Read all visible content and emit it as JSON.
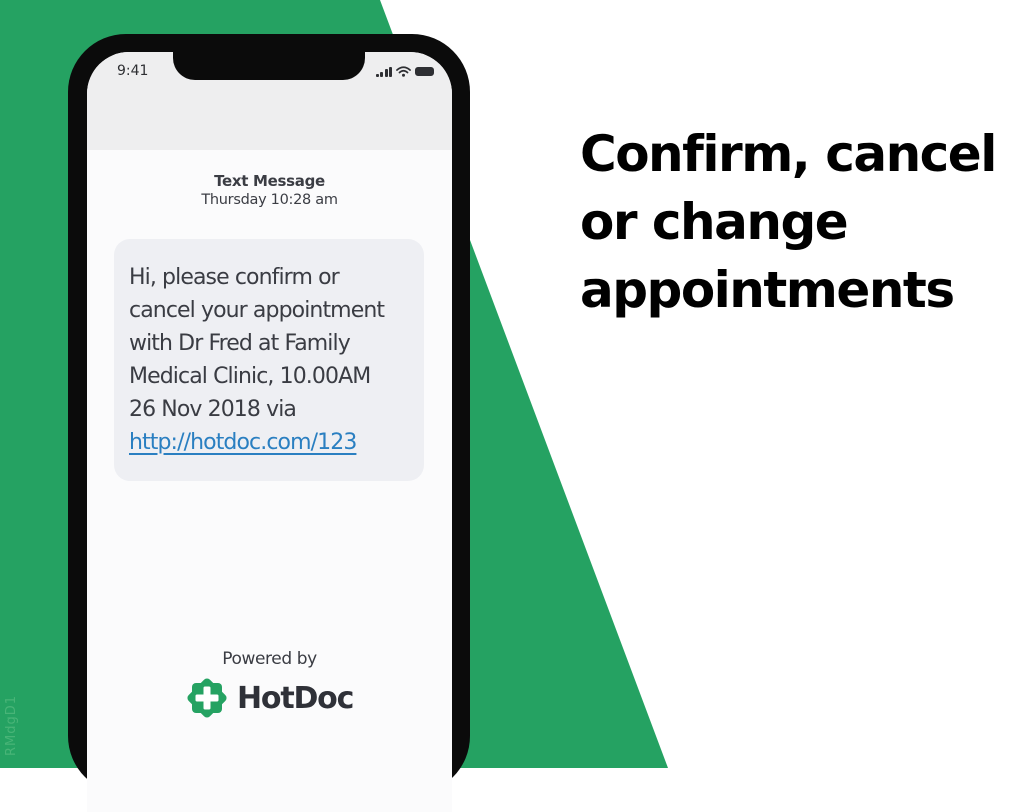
{
  "colors": {
    "brand_green": "#25a262",
    "phone_frame": "#0b0b0b",
    "status_bar_bg": "#eeeeef",
    "bubble_bg": "#eeeff3",
    "link": "#2a7fc1",
    "text_dark": "#3a3c43",
    "headline": "#000000"
  },
  "watermark": "RMdgD1",
  "phone": {
    "status_bar": {
      "time": "9:41",
      "icons": [
        "cellular-signal-icon",
        "wifi-icon",
        "battery-icon"
      ]
    },
    "message_header": {
      "title": "Text Message",
      "timestamp": "Thursday 10:28 am"
    },
    "message": {
      "lines": [
        "Hi, please confirm or",
        "cancel your appointment",
        "with Dr Fred at Family",
        "Medical Clinic, 10.00AM",
        "26 Nov 2018 via"
      ],
      "link": "http://hotdoc.com/123"
    },
    "footer": {
      "powered_by": "Powered by",
      "brand_name": "HotDoc",
      "brand_icon": "hotdoc-cross-badge-icon"
    }
  },
  "headline": {
    "lines": [
      "Confirm, cancel",
      "or change",
      "appointments"
    ]
  }
}
